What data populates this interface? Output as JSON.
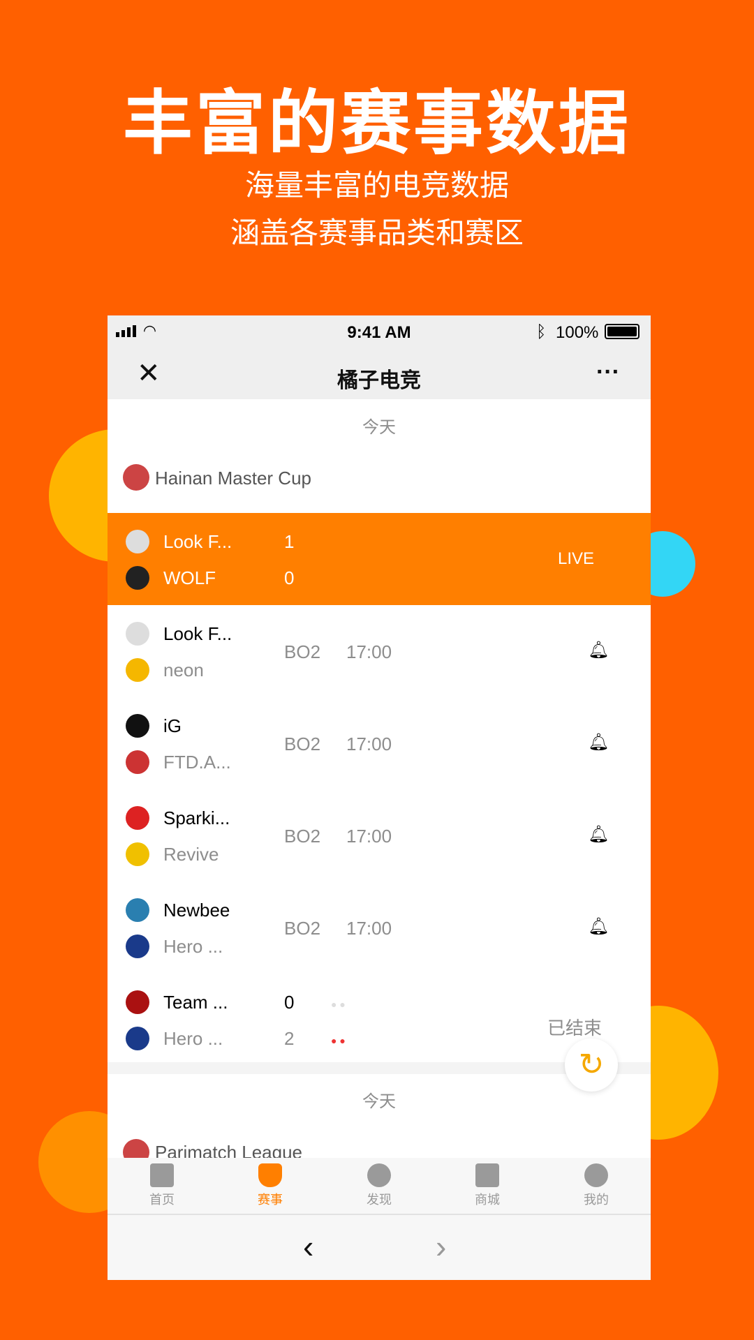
{
  "promo": {
    "headline": "丰富的赛事数据",
    "line1": "海量丰富的电竞数据",
    "line2": "涵盖各赛事品类和赛区"
  },
  "colors": {
    "background": "#FF6000",
    "accent": "#FF7F00",
    "yellow": "#FFB400",
    "cyan": "#33D6F5",
    "live_row": "#FF7F00"
  },
  "status": {
    "time": "9:41 AM",
    "battery": "100%"
  },
  "nav": {
    "title": "橘子电竞",
    "close": "close-icon",
    "more": "more-icon"
  },
  "section1": {
    "date": "今天",
    "league": "Hainan Master Cup"
  },
  "matches": [
    {
      "team1": "Look F...",
      "team2": "WOLF",
      "score1": "1",
      "score2": "0",
      "status": "LIVE"
    },
    {
      "team1": "Look F...",
      "team2": "neon",
      "format": "BO2",
      "time": "17:00"
    },
    {
      "team1": "iG",
      "team2": "FTD.A...",
      "format": "BO2",
      "time": "17:00"
    },
    {
      "team1": "Sparki...",
      "team2": "Revive",
      "format": "BO2",
      "time": "17:00"
    },
    {
      "team1": "Newbee",
      "team2": "Hero ...",
      "format": "BO2",
      "time": "17:00"
    },
    {
      "team1": "Team ...",
      "team2": "Hero ...",
      "score1": "0",
      "score2": "2",
      "status": "已结束"
    }
  ],
  "section2": {
    "date": "今天",
    "league": "Parimatch League"
  },
  "tabs": [
    {
      "label": "首页",
      "icon": "home-icon"
    },
    {
      "label": "赛事",
      "icon": "trophy-icon",
      "active": true
    },
    {
      "label": "发现",
      "icon": "discover-icon"
    },
    {
      "label": "商城",
      "icon": "shop-bag-icon"
    },
    {
      "label": "我的",
      "icon": "profile-icon"
    }
  ]
}
